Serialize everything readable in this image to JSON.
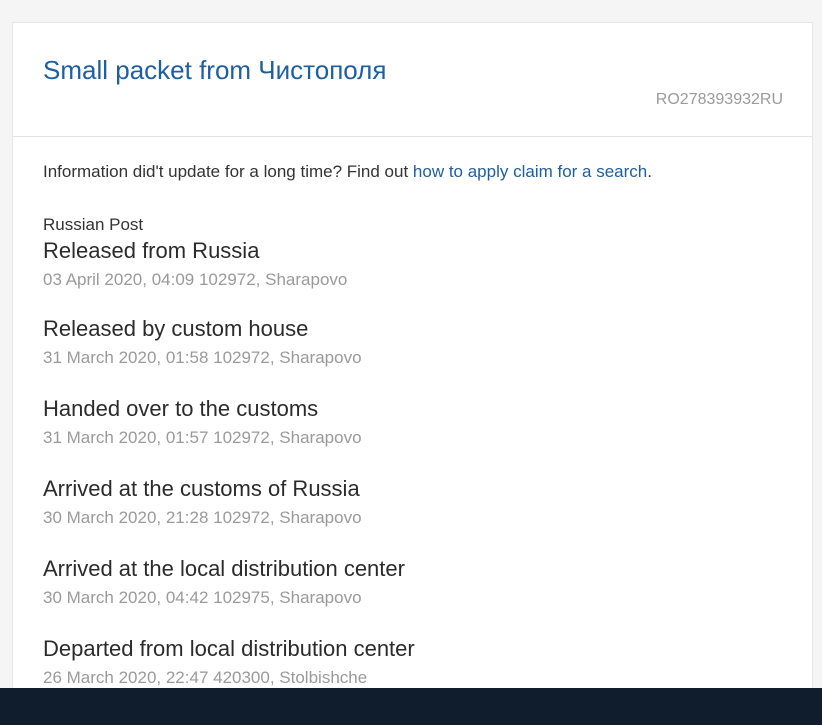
{
  "header": {
    "title": "Small packet from Чистополя",
    "tracking_number": "RO278393932RU"
  },
  "info": {
    "text": "Information did't update for a long time? Find out ",
    "link": "how to apply claim for a search",
    "suffix": "."
  },
  "carrier": "Russian Post",
  "events": [
    {
      "title": "Released from Russia",
      "meta": "03 April 2020, 04:09 102972, Sharapovo"
    },
    {
      "title": "Released by custom house",
      "meta": "31 March 2020, 01:58 102972, Sharapovo"
    },
    {
      "title": "Handed over to the customs",
      "meta": "31 March 2020, 01:57 102972, Sharapovo"
    },
    {
      "title": "Arrived at the customs of Russia",
      "meta": "30 March 2020, 21:28 102972, Sharapovo"
    },
    {
      "title": "Arrived at the local distribution center",
      "meta": "30 March 2020, 04:42 102975, Sharapovo"
    },
    {
      "title": "Departed from local distribution center",
      "meta": "26 March 2020, 22:47 420300, Stolbishche"
    }
  ]
}
